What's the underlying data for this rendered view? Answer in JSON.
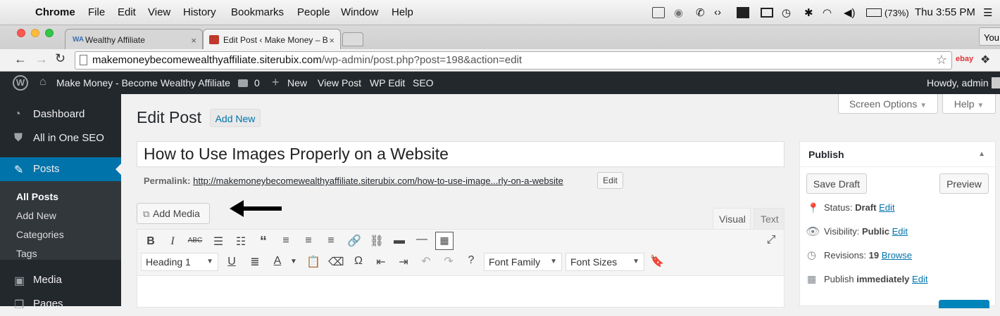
{
  "macbar": {
    "app": "Chrome",
    "menus": [
      "File",
      "Edit",
      "View",
      "History",
      "Bookmarks",
      "People",
      "Window",
      "Help"
    ],
    "battery": "(73%)",
    "clock": "Thu 3:55 PM"
  },
  "browser": {
    "tabs": [
      {
        "title": "Wealthy Affiliate",
        "active": false
      },
      {
        "title": "Edit Post ‹ Make Money – B",
        "active": true
      }
    ],
    "profile": "You",
    "url_host": "makemoneybecomewealthyaffiliate.siterubix.com",
    "url_path": "/wp-admin/post.php?post=198&action=edit",
    "ext_ebay": "ebay"
  },
  "adminbar": {
    "site": "Make Money - Become Wealthy Affiliate",
    "comments": "0",
    "new": "New",
    "view_post": "View Post",
    "wp_edit": "WP Edit",
    "seo": "SEO",
    "howdy": "Howdy, admin"
  },
  "sidebar": {
    "items": [
      {
        "label": "Dashboard",
        "icon": "dashboard-icon"
      },
      {
        "label": "All in One SEO",
        "icon": "shield-icon"
      },
      {
        "label": "Posts",
        "icon": "pin-icon"
      },
      {
        "label": "Media",
        "icon": "media-icon"
      },
      {
        "label": "Pages",
        "icon": "pages-icon"
      }
    ],
    "posts_submenu": [
      "All Posts",
      "Add New",
      "Categories",
      "Tags"
    ]
  },
  "editor": {
    "heading": "Edit Post",
    "add_new": "Add New",
    "title_value": "How to Use Images Properly on a Website",
    "permalink_label": "Permalink:",
    "permalink_url": "http://makemoneybecomewealthyaffiliate.siterubix.com/how-to-use-image...rly-on-a-website",
    "permalink_edit": "Edit",
    "add_media": "Add Media",
    "tab_visual": "Visual",
    "tab_text": "Text",
    "format_select": "Heading 1",
    "font_family": "Font Family",
    "font_sizes": "Font Sizes"
  },
  "screen_options": "Screen Options",
  "help": "Help",
  "publish": {
    "title": "Publish",
    "save_draft": "Save Draft",
    "preview": "Preview",
    "status_label": "Status:",
    "status_value": "Draft",
    "visibility_label": "Visibility:",
    "visibility_value": "Public",
    "revisions_label": "Revisions:",
    "revisions_value": "19",
    "browse": "Browse",
    "publish_label": "Publish",
    "publish_when": "immediately",
    "edit": "Edit"
  },
  "colors": {
    "wp_dark": "#23282d",
    "wp_blue": "#0073aa",
    "arrow": "#000000"
  }
}
